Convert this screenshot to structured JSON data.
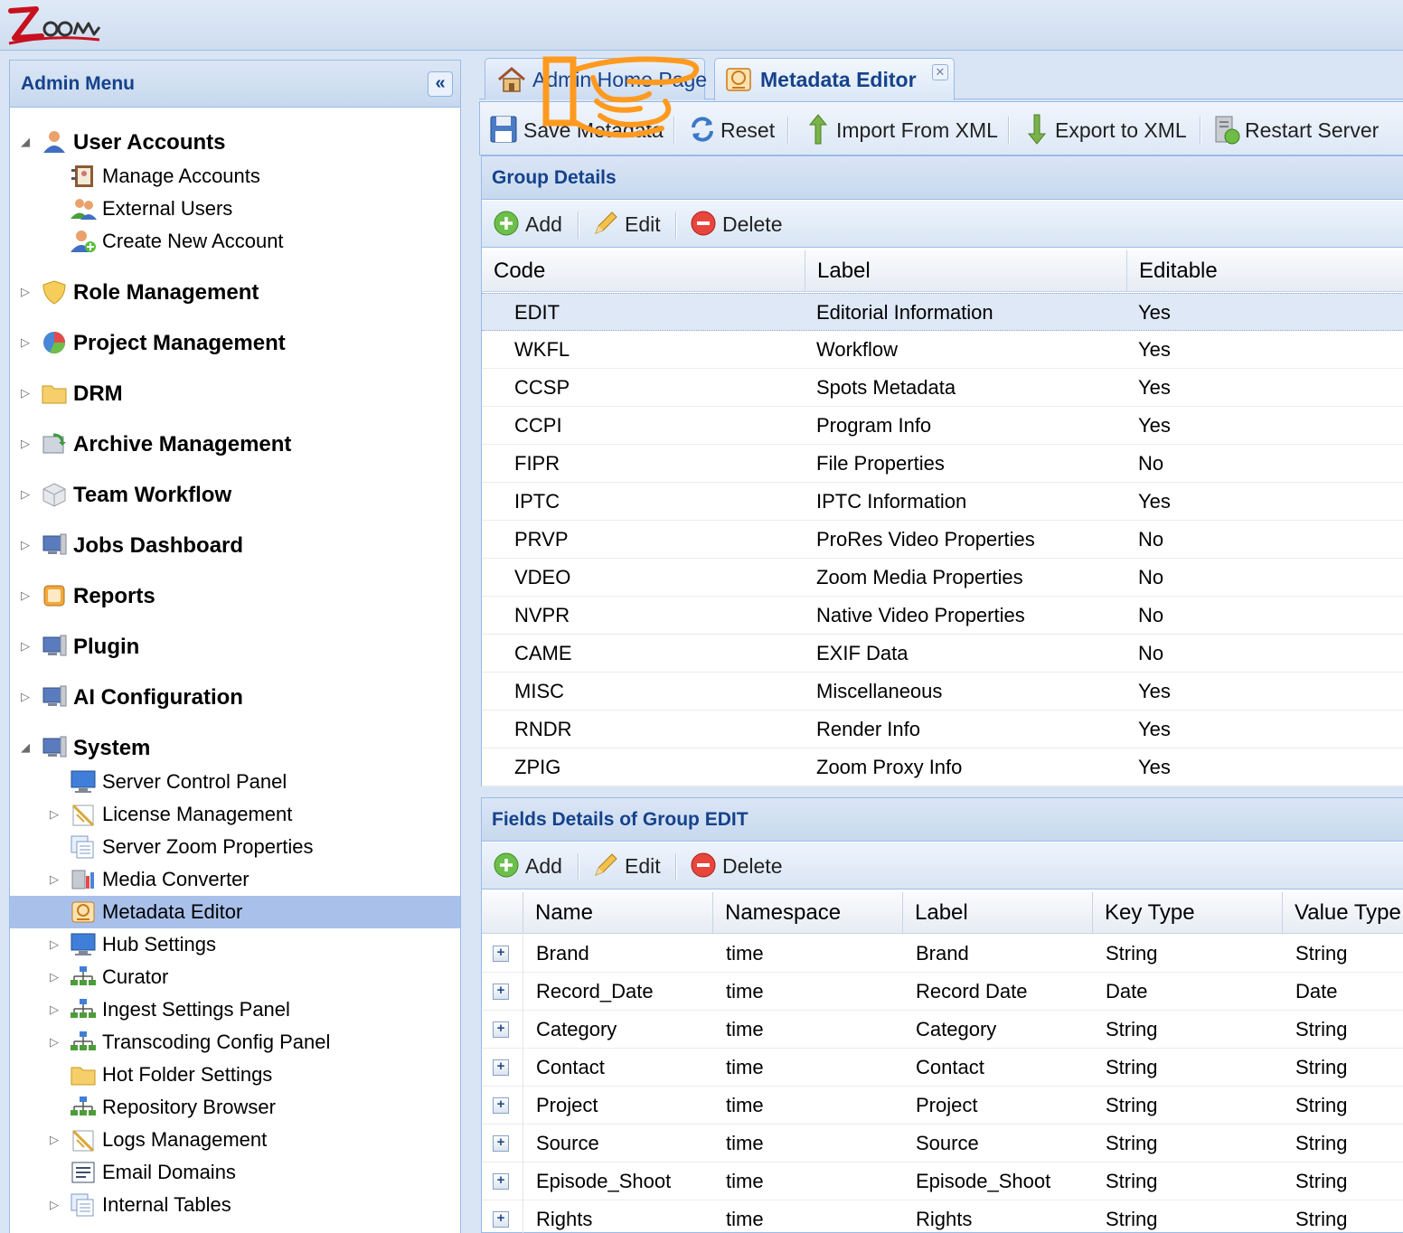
{
  "app": {
    "logo_text": "Zoom"
  },
  "sidebar": {
    "title": "Admin Menu",
    "collapse_icon": "double-chevron-left-icon",
    "items": [
      {
        "label": "User Accounts",
        "level": 1,
        "expander": "expanded",
        "icon": "users-icon"
      },
      {
        "label": "Manage Accounts",
        "level": 2,
        "expander": "none",
        "icon": "address-book-icon"
      },
      {
        "label": "External Users",
        "level": 2,
        "expander": "none",
        "icon": "user-group-icon"
      },
      {
        "label": "Create New Account",
        "level": 2,
        "expander": "none",
        "icon": "add-user-icon"
      },
      {
        "label": "Role Management",
        "level": 1,
        "expander": "collapsed",
        "icon": "shield-icon"
      },
      {
        "label": "Project Management",
        "level": 1,
        "expander": "collapsed",
        "icon": "pie-chart-icon"
      },
      {
        "label": "DRM",
        "level": 1,
        "expander": "collapsed",
        "icon": "folder-icon"
      },
      {
        "label": "Archive Management",
        "level": 1,
        "expander": "collapsed",
        "icon": "archive-icon"
      },
      {
        "label": "Team Workflow",
        "level": 1,
        "expander": "collapsed",
        "icon": "cube-icon"
      },
      {
        "label": "Jobs Dashboard",
        "level": 1,
        "expander": "collapsed",
        "icon": "monitor-icon"
      },
      {
        "label": "Reports",
        "level": 1,
        "expander": "collapsed",
        "icon": "report-icon"
      },
      {
        "label": "Plugin",
        "level": 1,
        "expander": "collapsed",
        "icon": "monitor-icon"
      },
      {
        "label": "AI Configuration",
        "level": 1,
        "expander": "collapsed",
        "icon": "monitor-icon"
      },
      {
        "label": "System",
        "level": 1,
        "expander": "expanded",
        "icon": "monitor-icon"
      },
      {
        "label": "Server Control Panel",
        "level": 2,
        "expander": "none",
        "icon": "screen-icon"
      },
      {
        "label": "License Management",
        "level": 2,
        "expander": "collapsed",
        "icon": "license-icon"
      },
      {
        "label": "Server Zoom Properties",
        "level": 2,
        "expander": "none",
        "icon": "properties-icon"
      },
      {
        "label": "Media Converter",
        "level": 2,
        "expander": "collapsed",
        "icon": "converter-icon"
      },
      {
        "label": "Metadata Editor",
        "level": 2,
        "expander": "none",
        "icon": "metadata-icon",
        "selected": true
      },
      {
        "label": "Hub Settings",
        "level": 2,
        "expander": "collapsed",
        "icon": "screen-icon"
      },
      {
        "label": "Curator",
        "level": 2,
        "expander": "collapsed",
        "icon": "network-icon"
      },
      {
        "label": "Ingest Settings Panel",
        "level": 2,
        "expander": "collapsed",
        "icon": "network-icon"
      },
      {
        "label": "Transcoding Config Panel",
        "level": 2,
        "expander": "collapsed",
        "icon": "network-icon"
      },
      {
        "label": "Hot Folder Settings",
        "level": 2,
        "expander": "none",
        "icon": "folder-icon"
      },
      {
        "label": "Repository Browser",
        "level": 2,
        "expander": "none",
        "icon": "network-icon"
      },
      {
        "label": "Logs Management",
        "level": 2,
        "expander": "collapsed",
        "icon": "license-icon"
      },
      {
        "label": "Email Domains",
        "level": 2,
        "expander": "none",
        "icon": "list-icon"
      },
      {
        "label": "Internal Tables",
        "level": 2,
        "expander": "collapsed",
        "icon": "properties-icon"
      }
    ]
  },
  "tabs": [
    {
      "label": "Admin Home Page",
      "icon": "home-icon",
      "active": false
    },
    {
      "label": "Metadata Editor",
      "icon": "metadata-icon",
      "active": true,
      "closable": true
    }
  ],
  "toolbar": {
    "save_label": "Save Metadata",
    "reset_label": "Reset",
    "import_label": "Import From XML",
    "export_label": "Export to XML",
    "restart_label": "Restart Server"
  },
  "group_panel": {
    "title": "Group Details",
    "add_label": "Add",
    "edit_label": "Edit",
    "delete_label": "Delete",
    "columns": [
      "Code",
      "Label",
      "Editable"
    ],
    "rows": [
      [
        "EDIT",
        "Editorial Information",
        "Yes"
      ],
      [
        "WKFL",
        "Workflow",
        "Yes"
      ],
      [
        "CCSP",
        "Spots Metadata",
        "Yes"
      ],
      [
        "CCPI",
        "Program Info",
        "Yes"
      ],
      [
        "FIPR",
        "File Properties",
        "No"
      ],
      [
        "IPTC",
        "IPTC Information",
        "Yes"
      ],
      [
        "PRVP",
        "ProRes Video Properties",
        "No"
      ],
      [
        "VDEO",
        "Zoom Media Properties",
        "No"
      ],
      [
        "NVPR",
        "Native Video Properties",
        "No"
      ],
      [
        "CAME",
        "EXIF Data",
        "No"
      ],
      [
        "MISC",
        "Miscellaneous",
        "Yes"
      ],
      [
        "RNDR",
        "Render Info",
        "Yes"
      ],
      [
        "ZPIG",
        "Zoom Proxy Info",
        "Yes"
      ]
    ],
    "selected_row": 0
  },
  "fields_panel": {
    "title": "Fields Details of Group EDIT",
    "add_label": "Add",
    "edit_label": "Edit",
    "delete_label": "Delete",
    "columns": [
      "Name",
      "Namespace",
      "Label",
      "Key Type",
      "Value Type"
    ],
    "rows": [
      [
        "Brand",
        "time",
        "Brand",
        "String",
        "String"
      ],
      [
        "Record_Date",
        "time",
        "Record Date",
        "Date",
        "Date"
      ],
      [
        "Category",
        "time",
        "Category",
        "String",
        "String"
      ],
      [
        "Contact",
        "time",
        "Contact",
        "String",
        "String"
      ],
      [
        "Project",
        "time",
        "Project",
        "String",
        "String"
      ],
      [
        "Source",
        "time",
        "Source",
        "String",
        "String"
      ],
      [
        "Episode_Shoot",
        "time",
        "Episode_Shoot",
        "String",
        "String"
      ],
      [
        "Rights",
        "time",
        "Rights",
        "String",
        "String"
      ]
    ],
    "expander_symbol": "+"
  },
  "colors": {
    "header_text": "#15428b",
    "border": "#99bbe8",
    "selection": "#a9c0ea",
    "hand_overlay": "#ff9a1f"
  }
}
